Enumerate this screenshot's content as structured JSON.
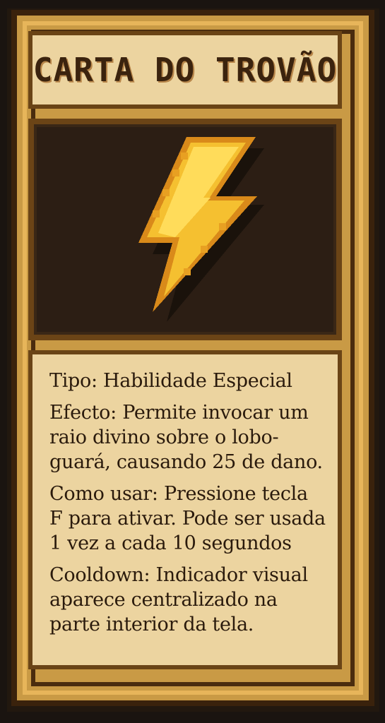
{
  "card": {
    "title": "CARTA DO TROVÃO",
    "icon": "lightning-bolt-icon",
    "colors": {
      "frame": "#c99a45",
      "frame_dark": "#3a220c",
      "parchment": "#ecd4a0",
      "art_background": "#2c1e14",
      "bolt_yellow": "#f5c030",
      "bolt_orange": "#d98a1a",
      "text": "#2a1a0c"
    },
    "description": {
      "tipo": "Tipo: Habilidade Especial",
      "efecto": "Efecto: Permite invocar um raio divino sobre o lobo-guará, causando 25 de dano.",
      "como_usar": "Como usar: Pressione tecla F para ativar. Pode ser usada 1 vez a cada 10 segundos",
      "cooldown": "Cooldown: Indicador visual aparece centralizado na parte interior da tela."
    }
  }
}
